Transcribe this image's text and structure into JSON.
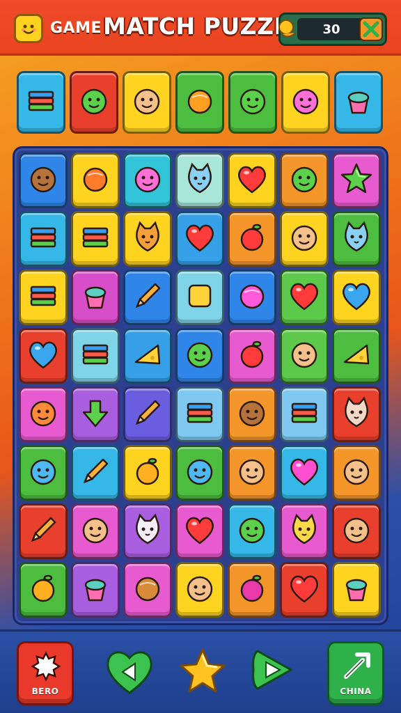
{
  "header": {
    "game_label": "GAME",
    "title": "MATCH PUZZLE",
    "score": "30",
    "logo_icon": "smiley-face-icon",
    "coin_icon": "coin-hand-icon",
    "tool_icon": "crossed-tools-icon"
  },
  "colors": {
    "header_bg": "#e8451f",
    "board_bg": "#2d3f8f",
    "bottom_bg": "#1f3f8c",
    "red_button": "#e8392a",
    "green_button": "#2fb14a"
  },
  "top_row": [
    {
      "icon": "scroll-icon",
      "color": "#35b7e8"
    },
    {
      "icon": "green-hat-kid-icon",
      "color": "#e9402d"
    },
    {
      "icon": "sunglasses-man-icon",
      "color": "#ffd420"
    },
    {
      "icon": "ring-gem-icon",
      "color": "#4cbd3f"
    },
    {
      "icon": "green-dino-icon",
      "color": "#4cbd3f"
    },
    {
      "icon": "pink-hair-kid-icon",
      "color": "#ffd420"
    },
    {
      "icon": "cupcake-crown-icon",
      "color": "#35b7e8"
    }
  ],
  "board": {
    "rows": [
      [
        {
          "icon": "bear-face-icon",
          "color": "#2f86e8"
        },
        {
          "icon": "ball-icon",
          "color": "#ffd420"
        },
        {
          "icon": "pink-blob-icon",
          "color": "#32c4d8"
        },
        {
          "icon": "blue-cat-icon",
          "color": "#a8e6d8"
        },
        {
          "icon": "heart-potion-icon",
          "color": "#ffd420"
        },
        {
          "icon": "green-slime-icon",
          "color": "#f5962a"
        },
        {
          "icon": "star-icon",
          "color": "#e85bd0"
        }
      ],
      [
        {
          "icon": "map-icon",
          "color": "#35b7e8"
        },
        {
          "icon": "book-shelf-icon",
          "color": "#ffd420"
        },
        {
          "icon": "fox-face-icon",
          "color": "#ffd420"
        },
        {
          "icon": "heart-icon",
          "color": "#35a0e8"
        },
        {
          "icon": "strawberry-icon",
          "color": "#f5962a"
        },
        {
          "icon": "lion-face-icon",
          "color": "#ffd420"
        },
        {
          "icon": "blue-cat-face-icon",
          "color": "#4cbd3f"
        }
      ],
      [
        {
          "icon": "flag-icon",
          "color": "#ffd420"
        },
        {
          "icon": "potion-bottle-icon",
          "color": "#d84ec8"
        },
        {
          "icon": "pencil-icon",
          "color": "#2f86e8"
        },
        {
          "icon": "treasure-box-icon",
          "color": "#7fd4e8"
        },
        {
          "icon": "pink-drop-icon",
          "color": "#2f86e8"
        },
        {
          "icon": "red-heart-icon",
          "color": "#5cc94a"
        },
        {
          "icon": "blue-heart-icon",
          "color": "#ffd420"
        }
      ],
      [
        {
          "icon": "blue-heart-icon",
          "color": "#e9402d"
        },
        {
          "icon": "books-stack-icon",
          "color": "#7fd4e8"
        },
        {
          "icon": "cheese-icon",
          "color": "#35a0e8"
        },
        {
          "icon": "green-monster-icon",
          "color": "#2f86e8"
        },
        {
          "icon": "apple-icon",
          "color": "#e85bd0"
        },
        {
          "icon": "sun-face-icon",
          "color": "#5cc94a"
        },
        {
          "icon": "cheese-wedge-icon",
          "color": "#4cbd3f"
        }
      ],
      [
        {
          "icon": "orange-face-icon",
          "color": "#e85bd0"
        },
        {
          "icon": "green-arrow-icon",
          "color": "#a95ee0"
        },
        {
          "icon": "scissors-icon",
          "color": "#6a5ee0"
        },
        {
          "icon": "tray-icon",
          "color": "#7fc8f0"
        },
        {
          "icon": "monkey-face-icon",
          "color": "#f5962a"
        },
        {
          "icon": "books-stack-icon",
          "color": "#7fc8f0"
        },
        {
          "icon": "puppy-face-icon",
          "color": "#e9402d"
        }
      ],
      [
        {
          "icon": "blue-smiley-icon",
          "color": "#4cbd3f"
        },
        {
          "icon": "crayon-icon",
          "color": "#35b7e8"
        },
        {
          "icon": "orange-fish-icon",
          "color": "#ffd420"
        },
        {
          "icon": "blue-blob-icon",
          "color": "#4cbd3f"
        },
        {
          "icon": "lion-cub-icon",
          "color": "#f5962a"
        },
        {
          "icon": "pink-heart-icon",
          "color": "#35b7e8"
        },
        {
          "icon": "boy-face-icon",
          "color": "#f5962a"
        }
      ],
      [
        {
          "icon": "harp-icon",
          "color": "#e9402d"
        },
        {
          "icon": "pot-face-icon",
          "color": "#e85bd0"
        },
        {
          "icon": "white-cat-icon",
          "color": "#a95ee0"
        },
        {
          "icon": "apple-heart-icon",
          "color": "#e85bd0"
        },
        {
          "icon": "green-pea-icon",
          "color": "#35b7e8"
        },
        {
          "icon": "yellow-cat-icon",
          "color": "#e85bd0"
        },
        {
          "icon": "hat-man-icon",
          "color": "#e9402d"
        }
      ],
      [
        {
          "icon": "orange-fruit-icon",
          "color": "#4cbd3f"
        },
        {
          "icon": "bowl-icon",
          "color": "#a95ee0"
        },
        {
          "icon": "cookie-icon",
          "color": "#e85bd0"
        },
        {
          "icon": "chick-face-icon",
          "color": "#ffd420"
        },
        {
          "icon": "berry-icon",
          "color": "#f5962a"
        },
        {
          "icon": "heart-frame-icon",
          "color": "#e9402d"
        },
        {
          "icon": "cake-icon",
          "color": "#ffd420"
        }
      ]
    ]
  },
  "bottom": {
    "left_label": "BERO",
    "right_label": "CHINA",
    "left_icon": "star-badge-icon",
    "heart_icon": "green-heart-back-icon",
    "star_icon": "gold-star-icon",
    "arrow_icon": "green-play-icon",
    "right_icon": "pickaxe-icon"
  }
}
